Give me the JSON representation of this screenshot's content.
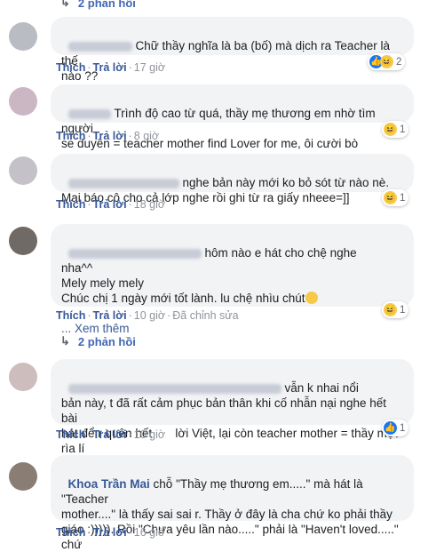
{
  "top_replies": {
    "label": "2 phản hồi"
  },
  "comments": [
    {
      "text": "Chữ thầy nghĩa là ba (bố) mà dịch ra Teacher là thế\nnào ??",
      "actions": {
        "like": "Thích",
        "reply": "Trả lời",
        "time": "17 giờ"
      },
      "reactions": {
        "count": "2",
        "icons": [
          "like-icon",
          "haha-icon"
        ]
      }
    },
    {
      "text": "Trình độ cao từ quá, thầy mẹ thương em nhờ tìm người\nse duyên = teacher mother find Lover for me, ôi cười bò",
      "actions": {
        "like": "Thích",
        "reply": "Trả lời",
        "time": "8 giờ"
      },
      "reactions": {
        "count": "1",
        "icons": [
          "haha-icon"
        ]
      }
    },
    {
      "text": "nghe bản này mới ko bỏ sót từ nào nè.\nMai báo cô cho cả lớp nghe rồi ghi từ ra giấy nheee=]]",
      "actions": {
        "like": "Thích",
        "reply": "Trả lời",
        "time": "18 giờ"
      },
      "reactions": {
        "count": "1",
        "icons": [
          "haha-icon"
        ]
      }
    },
    {
      "text": "hôm nào e hát cho chệ nghe\nnha^^\nMely mely mely\nChúc chị 1 ngày mới tốt lành. lu chệ nhìu chút",
      "see_more": "Xem thêm",
      "actions": {
        "like": "Thích",
        "reply": "Trả lời",
        "time": "10 giờ",
        "edited": "Đã chỉnh sửa"
      },
      "reactions": {
        "count": "1",
        "icons": [
          "haha-icon"
        ]
      }
    },
    {
      "replies": "2 phản hồi"
    },
    {
      "text": "vẫn k nhai nổi\nbản này, t đã rất cảm phục bản thân khi cố nhẫn nại nghe hết bài\nhát để r quên hết       lời Việt, lại còn teacher mother = thầy mẹ?\nrìa lí",
      "actions": {
        "like": "Thích",
        "reply": "Trả lời",
        "time": "10 giờ"
      },
      "reactions": {
        "count": "1",
        "icons": [
          "like-icon"
        ]
      }
    },
    {
      "name": "Khoa Trần Mai",
      "text": "chỗ \"Thầy mẹ thương em.....\" mà hát là \"Teacher\nmother....\" là thấy sai sai r. Thầy ở đây là cha chứ ko phải thầy\ngiáo :))))). Rồi \"Chưa yêu lần nào.....\" phải là \"Haven't loved.....\"\nchứ",
      "actions": {
        "like": "Thích",
        "reply": "Trả lời",
        "time": "16 giờ"
      }
    }
  ],
  "colors": {
    "link": "#385898",
    "bubble": "#f2f3f5",
    "meta": "#90949c"
  }
}
